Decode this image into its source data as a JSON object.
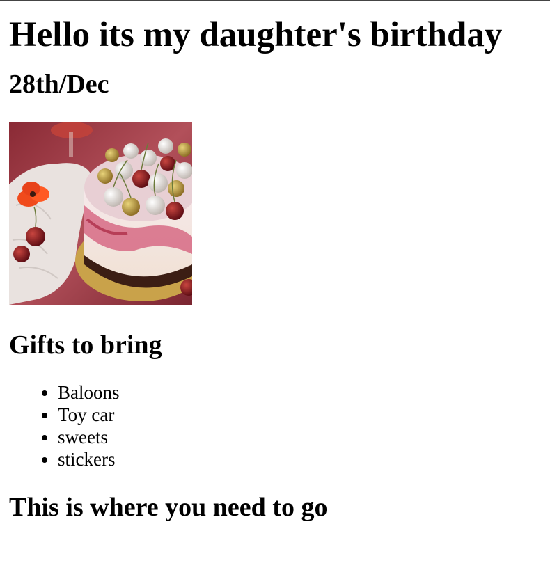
{
  "heading": "Hello its my daughter's birthday",
  "date": "28th/Dec",
  "image": {
    "icon": "birthday-cake-photo"
  },
  "gifts": {
    "heading": "Gifts to bring",
    "items": [
      "Baloons",
      "Toy car",
      "sweets",
      "stickers"
    ]
  },
  "directions": {
    "heading": "This is where you need to go"
  },
  "colors": {
    "text": "#000000",
    "background": "#ffffff",
    "top_border": "#444444"
  }
}
